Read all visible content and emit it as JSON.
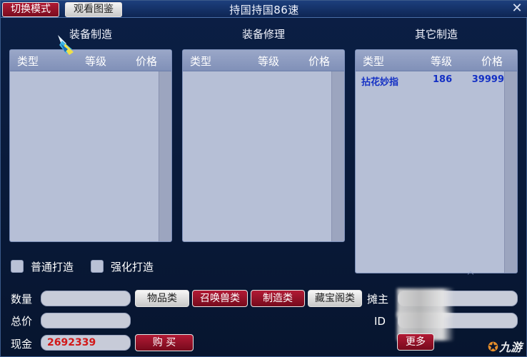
{
  "header": {
    "switch_mode": "切换模式",
    "view_gallery": "观看图鉴",
    "title": "持国持国86速",
    "close": "✕"
  },
  "panels": [
    {
      "title": "装备制造",
      "headers": {
        "type": "类型",
        "level": "等级",
        "price": "价格"
      },
      "rows": []
    },
    {
      "title": "装备修理",
      "headers": {
        "type": "类型",
        "level": "等级",
        "price": "价格"
      },
      "rows": []
    },
    {
      "title": "其它制造",
      "headers": {
        "type": "类型",
        "level": "等级",
        "price": "价格"
      },
      "rows": [
        {
          "name": "拈花妙指",
          "level": "186",
          "price": "39999"
        }
      ]
    }
  ],
  "options": {
    "normal": "普通打造",
    "enhanced": "强化打造"
  },
  "form": {
    "quantity_label": "数量",
    "total_label": "总价",
    "cash_label": "现金",
    "cash_value": "2692339",
    "owner_label": "摊主",
    "id_label": "ID"
  },
  "buttons": {
    "items": "物品类",
    "summon": "召唤兽类",
    "craft": "制造类",
    "treasure": "藏宝阁类",
    "buy": "购 买",
    "more": "更多"
  },
  "watermark": {
    "text": "九游"
  },
  "colors": {
    "accent_red": "#9a1129",
    "panel_bg": "#b6bfd6",
    "cash_text": "#d21818",
    "row_text": "#1430c4"
  }
}
